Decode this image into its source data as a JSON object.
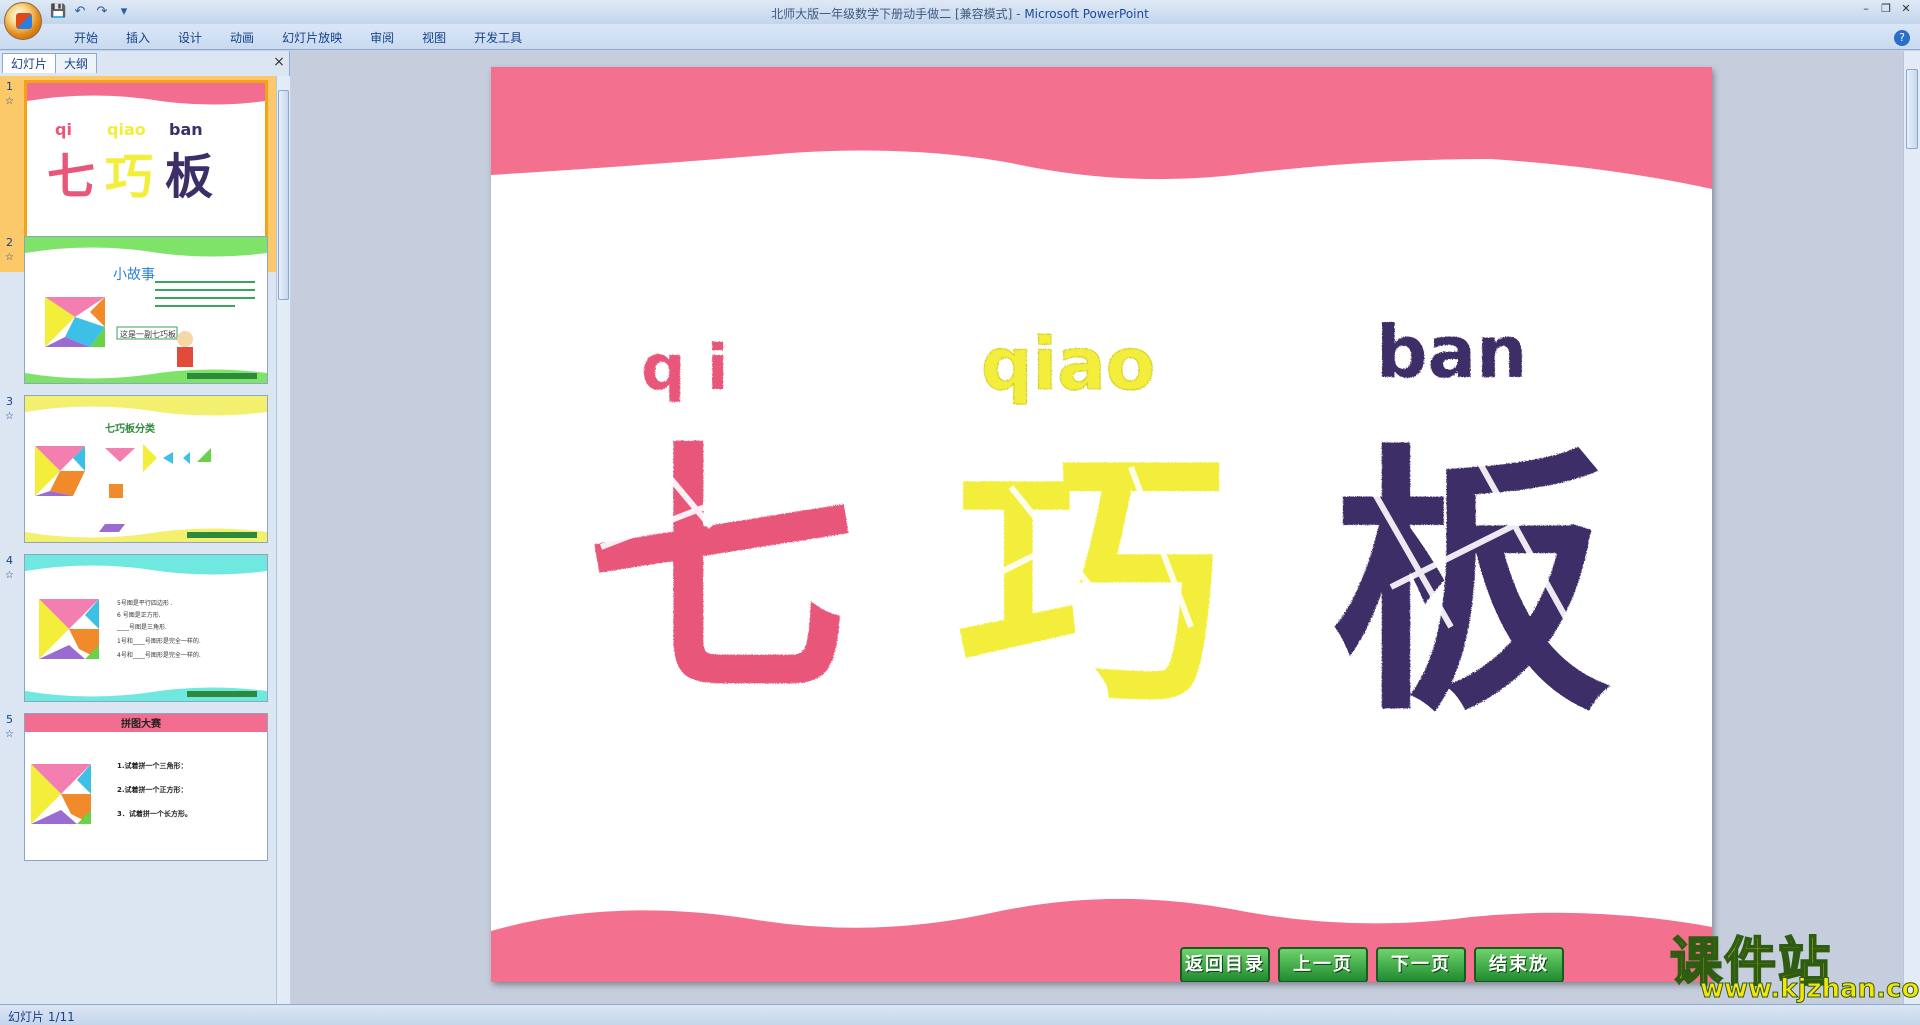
{
  "window": {
    "title": "北师大版一年级数学下册动手做二 [兼容模式]",
    "app_name": "Microsoft PowerPoint",
    "title_sep": " - "
  },
  "ribbon": {
    "tabs": [
      "开始",
      "插入",
      "设计",
      "动画",
      "幻灯片放映",
      "审阅",
      "视图",
      "开发工具"
    ]
  },
  "pane": {
    "tabs": [
      "幻灯片",
      "大纲"
    ],
    "close": "×"
  },
  "thumbnails": [
    {
      "num": "1",
      "pinyin": [
        "qi",
        "qiao",
        "ban"
      ],
      "chars": [
        "七",
        "巧",
        "板"
      ],
      "colors": [
        "#e8577a",
        "#f2ee3a",
        "#3c2f67"
      ],
      "band": "#f26d8f"
    },
    {
      "num": "2",
      "heading": "小故事",
      "caption": "这是一副七巧板",
      "band": "#7fe36a"
    },
    {
      "num": "3",
      "heading": "七巧板分类",
      "band": "#f3f070"
    },
    {
      "num": "4",
      "lines": [
        "5号图是平行四边形 .",
        "6 号图是正方形.",
        "____号图是三角形.",
        "1号和____号图形是完全一样的.",
        "4号和____号图形是完全一样的."
      ],
      "band": "#6fe8e0"
    },
    {
      "num": "5",
      "heading": "拼图大赛",
      "lines": [
        "1.试着拼一个三角形：",
        "2.试着拼一个正方形：",
        "3．试着拼一个长方形。"
      ],
      "band": "#f26d8f"
    }
  ],
  "slide": {
    "pinyin": [
      "q i",
      "qiao",
      "ban"
    ],
    "chars": [
      "七",
      "巧",
      "板"
    ],
    "colors": {
      "qi": "#e8577a",
      "qiao": "#f2ee3a",
      "ban": "#3c2f67",
      "band": "#f4708f"
    },
    "nav_buttons": [
      "返回目录",
      "上一页",
      "下一页",
      "结束放"
    ]
  },
  "status": {
    "text": "幻灯片 1/11"
  },
  "watermark": {
    "main": "课件站",
    "url": "www.kjzhan.com"
  }
}
